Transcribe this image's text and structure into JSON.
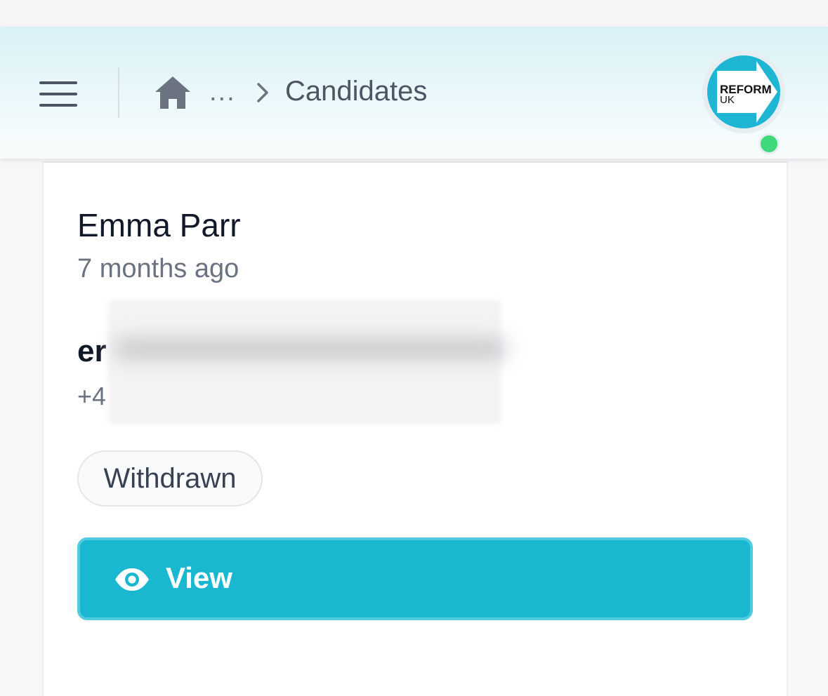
{
  "header": {
    "breadcrumb": {
      "ellipsis": "...",
      "current": "Candidates"
    },
    "avatar": {
      "logo_line1": "REFORM",
      "logo_line2": "UK",
      "status": "online"
    }
  },
  "candidate": {
    "name": "Emma Parr",
    "time_ago": "7 months ago",
    "email_visible": "er",
    "phone_visible": "+4",
    "status_badge": "Withdrawn",
    "view_label": "View"
  },
  "colors": {
    "accent": "#1ab7d1",
    "online": "#3dd97a",
    "logo_bg": "#1fb6d3"
  },
  "icons": [
    "menu-icon",
    "home-icon",
    "chevron-right-icon",
    "eye-icon"
  ]
}
